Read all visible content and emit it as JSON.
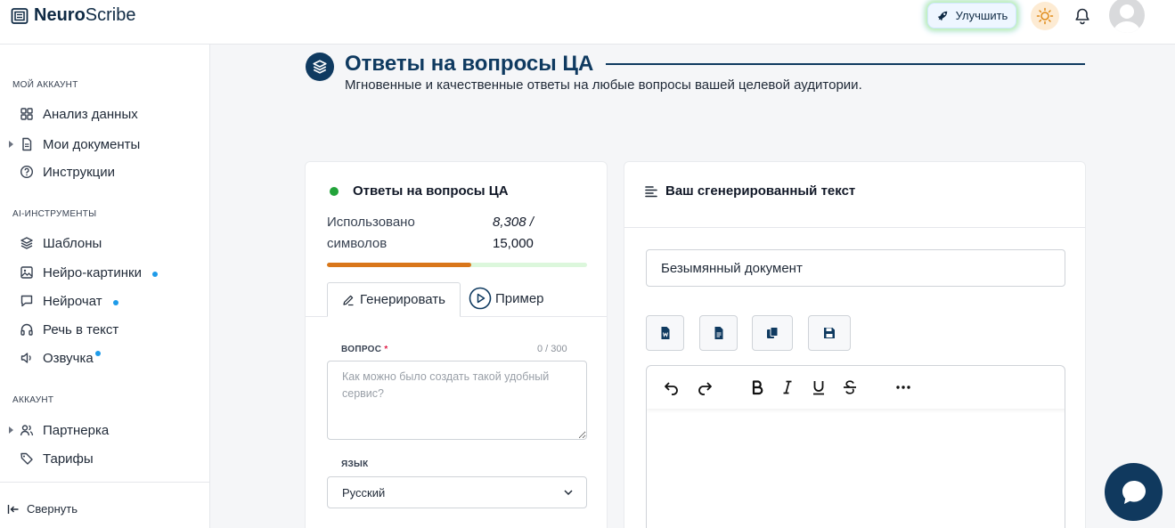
{
  "brand": {
    "bold": "Neuro",
    "regular": "Scribe"
  },
  "header": {
    "upgrade_label": "Улучшить"
  },
  "sidebar": {
    "section_account_label": "Мой аккаунт",
    "section_ai_label": "AI-инструменты",
    "section_settings_label": "Аккаунт",
    "items": [
      {
        "label": "Анализ данных"
      },
      {
        "label": "Мои документы"
      },
      {
        "label": "Инструкции"
      },
      {
        "label": "Шаблоны"
      },
      {
        "label": "Нейро-картинки"
      },
      {
        "label": "Нейрочат"
      },
      {
        "label": "Речь в текст"
      },
      {
        "label": "Озвучка"
      },
      {
        "label": "Партнерка"
      },
      {
        "label": "Тарифы"
      }
    ],
    "collapse_label": "Свернуть"
  },
  "page": {
    "title": "Ответы на вопросы ЦА",
    "subtitle": "Мгновенные и качественные ответы на любые вопросы вашей целевой аудитории."
  },
  "generator": {
    "title": "Ответы на вопросы ЦА",
    "usage_label": "Использовано символов",
    "usage_used": "8,308",
    "usage_separator": " /",
    "usage_total": "15,000",
    "usage_fraction": 0.554,
    "tab_generate": "Генерировать",
    "tab_example": "Пример",
    "question_label": "Вопрос",
    "question_required": "*",
    "question_counter": "0 / 300",
    "question_value": "",
    "question_placeholder": "Как можно было создать такой удобный сервис?",
    "language_label": "Язык",
    "language_value": "Русский"
  },
  "output": {
    "title": "Ваш сгенерированный текст",
    "document_name": "Безымянный документ"
  },
  "colors": {
    "brand_navy": "#0f3a60",
    "progress_fill": "#d9761a",
    "progress_track": "#dcf7dc",
    "status_green": "#22a33a",
    "badge_blue": "#1e9be9"
  }
}
